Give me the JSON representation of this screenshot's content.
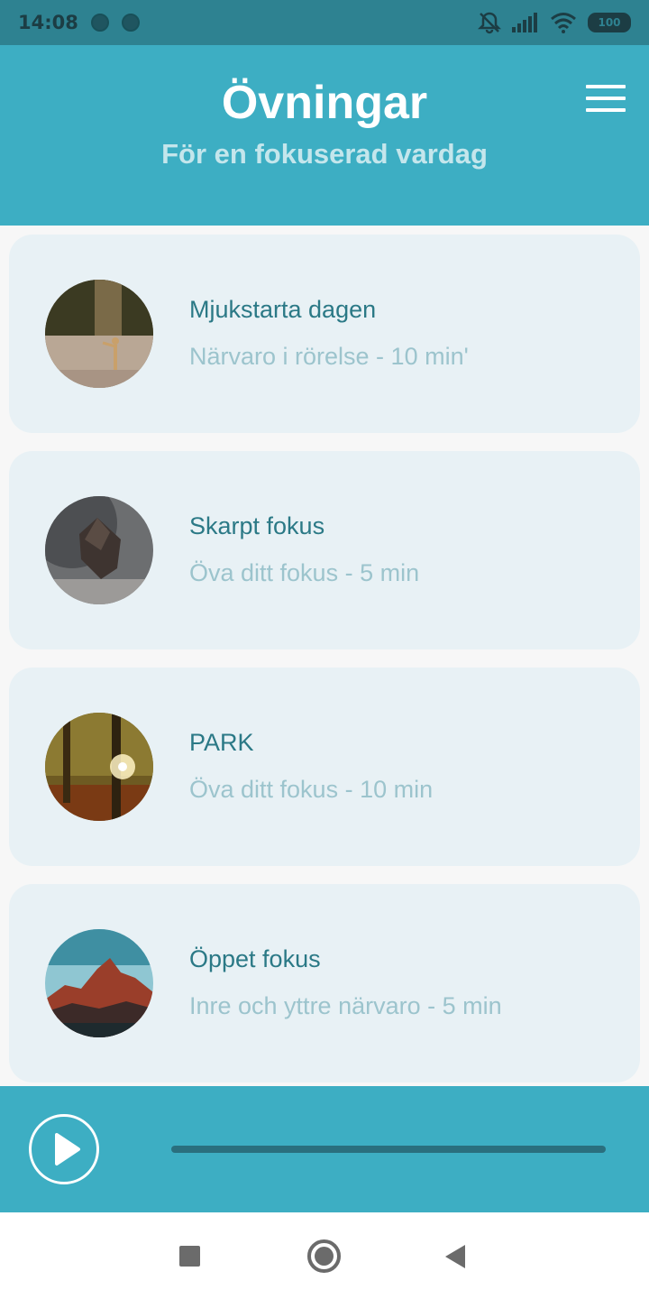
{
  "status_bar": {
    "time": "14:08",
    "battery": "100",
    "icons": [
      "notification-dot-icon",
      "notification-dot-icon",
      "mute-bell-icon",
      "signal-icon",
      "wifi-icon",
      "battery-icon"
    ]
  },
  "header": {
    "title": "Övningar",
    "subtitle": "För en fokuserad vardag",
    "menu_icon": "hamburger-menu-icon"
  },
  "exercises": [
    {
      "title": "Mjukstarta dagen",
      "subtitle": "Närvaro i rörelse - 10 min'",
      "image": "person-stretching-by-lake"
    },
    {
      "title": "Skarpt fokus",
      "subtitle": "Öva ditt fokus - 5 min",
      "image": "balanced-rock"
    },
    {
      "title": "PARK",
      "subtitle": "Öva ditt fokus - 10 min",
      "image": "sunlit-forest"
    },
    {
      "title": "Öppet fokus",
      "subtitle": "Inre och yttre närvaro - 5 min",
      "image": "mountain-at-sunset"
    }
  ],
  "player": {
    "play_icon": "play-icon",
    "progress": 0
  },
  "nav_bar": {
    "icons": [
      "recents-square-icon",
      "home-circle-icon",
      "back-triangle-icon"
    ]
  },
  "colors": {
    "status_bar": "#2e8291",
    "header": "#3daec3",
    "card": "#e8f1f5",
    "card_title": "#2b7986",
    "card_subtitle": "#9cc4cd"
  }
}
